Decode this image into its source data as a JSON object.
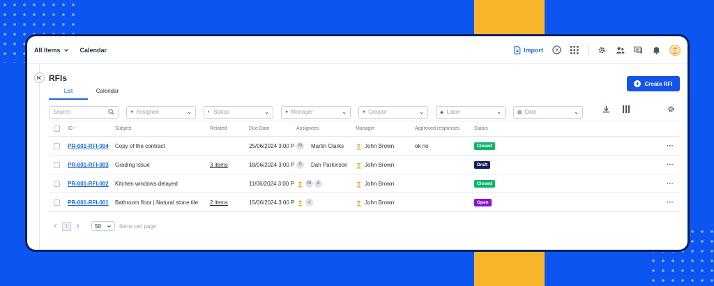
{
  "colors": {
    "background": "#0d55f0",
    "accent_bar": "#f7b52a",
    "primary": "#1454e8",
    "link": "#1668dc",
    "status_closed": "#0fb76c",
    "status_draft": "#17215e",
    "status_open": "#8a13d6"
  },
  "topbar": {
    "all_items": "All Items",
    "calendar": "Calendar",
    "import": "Import",
    "icons": [
      "import-icon",
      "help-icon",
      "apps-grid-icon",
      "gear-icon",
      "users-icon",
      "comments-icon",
      "bell-icon",
      "avatar"
    ]
  },
  "page": {
    "title": "RFIs",
    "create_button": "Create RFI",
    "tabs": [
      {
        "label": "List",
        "active": true
      },
      {
        "label": "Calendar",
        "active": false
      }
    ]
  },
  "filters": {
    "search_placeholder": "Search",
    "dropdowns": [
      "Assignee",
      "Status",
      "Manager",
      "Creator",
      "Label",
      "Date"
    ]
  },
  "table": {
    "headers": {
      "id": "ID ↑",
      "subject": "Subject",
      "related": "Related",
      "due_date": "Due Date",
      "assignees": "Assignees",
      "manager": "Manager",
      "approved": "Approved responses",
      "status": "Status"
    },
    "rows": [
      {
        "id": "PR-001-RFI-004",
        "subject": "Copy of the contract",
        "related": "",
        "due": "25/06/2024 3:00 P",
        "assignee_initials": [
          "M"
        ],
        "assignee_name": "Martin Clarks",
        "manager": "John Brown",
        "approved": "ok no",
        "status": "Closed",
        "status_color": "#0fb76c"
      },
      {
        "id": "PR-001-RFI-003",
        "subject": "Grading Issue",
        "related": "3 items",
        "due": "18/06/2024 3:00 P",
        "assignee_initials": [
          "D"
        ],
        "assignee_name": "Dan Parkinson",
        "manager": "John Brown",
        "approved": "",
        "status": "Draft",
        "status_color": "#17215e"
      },
      {
        "id": "PR-001-RFI-002",
        "subject": "Kitchen windows delayed",
        "related": "",
        "due": "11/06/2024 3:00 P",
        "assignee_initials": [
          "worker",
          "M",
          "A"
        ],
        "assignee_name": "",
        "manager": "John Brown",
        "approved": "",
        "status": "Closed",
        "status_color": "#0fb76c"
      },
      {
        "id": "PR-001-RFI-001",
        "subject": "Bathroom floor | Natural stone tile",
        "related": "2 items",
        "due": "15/06/2024 3:00 P",
        "assignee_initials": [
          "worker",
          "J"
        ],
        "assignee_name": "",
        "manager": "John Brown",
        "approved": "",
        "status": "Open",
        "status_color": "#8a13d6"
      }
    ]
  },
  "pagination": {
    "current_page": "1",
    "per_page": "50",
    "per_page_label": "Items per page"
  }
}
